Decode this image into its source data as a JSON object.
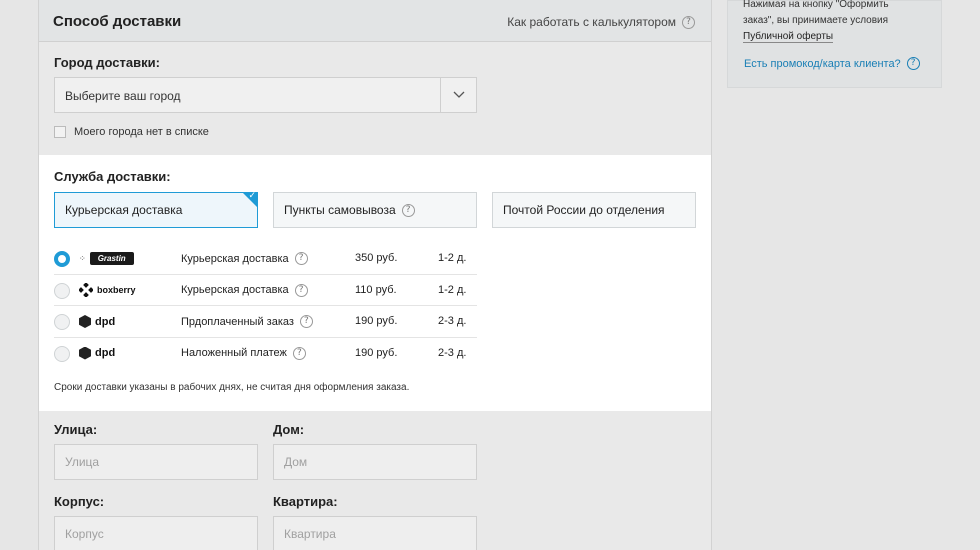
{
  "header": {
    "title": "Способ доставки",
    "calc_link": "Как работать с калькулятором"
  },
  "city": {
    "label": "Город доставки:",
    "placeholder": "Выберите ваш город",
    "no_city_label": "Моего города нет в списке"
  },
  "service": {
    "label": "Служба доставки:",
    "tabs": [
      {
        "label": "Курьерская доставка",
        "active": true
      },
      {
        "label": "Пункты самовывоза",
        "active": false
      },
      {
        "label": "Почтой России до отделения",
        "active": false
      }
    ],
    "rows": [
      {
        "logo": "Grastin",
        "service": "Курьерская доставка",
        "price": "350 руб.",
        "days": "1-2 д.",
        "selected": true
      },
      {
        "logo": "boxberry",
        "service": "Курьерская доставка",
        "price": "110 руб.",
        "days": "1-2 д.",
        "selected": false
      },
      {
        "logo": "dpd",
        "service": "Прдоплаченный заказ",
        "price": "190 руб.",
        "days": "2-3 д.",
        "selected": false
      },
      {
        "logo": "dpd",
        "service": "Наложенный платеж",
        "price": "190 руб.",
        "days": "2-3 д.",
        "selected": false
      }
    ],
    "note": "Сроки доставки указаны в рабочих днях, не считая дня оформления заказа."
  },
  "address": {
    "street_label": "Улица:",
    "street_placeholder": "Улица",
    "house_label": "Дом:",
    "house_placeholder": "Дом",
    "building_label": "Корпус:",
    "building_placeholder": "Корпус",
    "apartment_label": "Квартира:",
    "apartment_placeholder": "Квартира"
  },
  "sidebar": {
    "line1": "Нажимая на кнопку \"Оформить",
    "line2": "заказ\", вы принимаете условия",
    "offer_link": "Публичной оферты",
    "promo_link": "Есть промокод/карта клиента?"
  },
  "colors": {
    "accent": "#1f9bd6",
    "link": "#1a7fb5"
  },
  "icons": {
    "help": "?",
    "chevron": "chevron-down-icon",
    "check": "✓"
  }
}
